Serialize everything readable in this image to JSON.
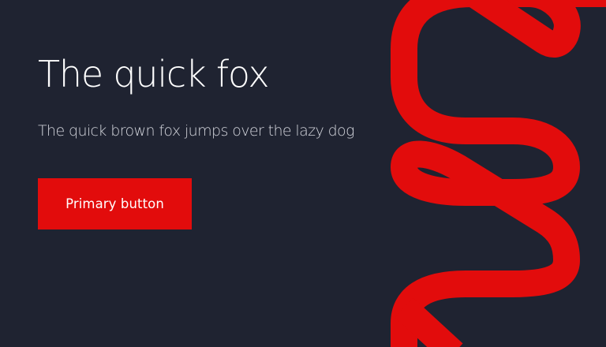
{
  "theme": {
    "background": "#1f2331",
    "accent": "#e20c0c",
    "text_primary": "#ffffff",
    "text_secondary": "#d4d6dd"
  },
  "hero": {
    "title": "The quick fox",
    "subtitle": "The quick brown fox jumps over the lazy dog",
    "primary_button_label": "Primary button"
  },
  "decoration": {
    "icon": "red-squiggle-line"
  }
}
